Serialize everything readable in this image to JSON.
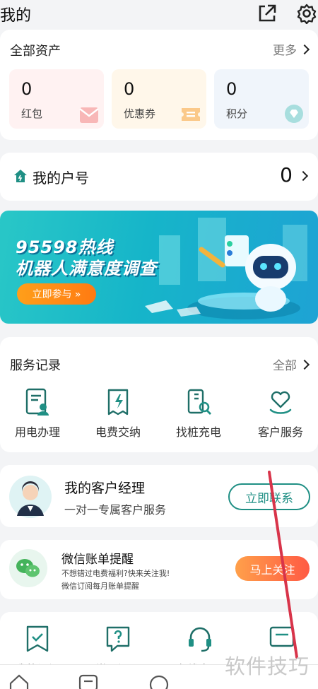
{
  "header": {
    "title": "我的",
    "share_icon": "share-external-icon",
    "settings_icon": "gear-icon"
  },
  "assets": {
    "title": "全部资产",
    "more": "更多",
    "items": [
      {
        "value": "0",
        "label": "红包",
        "bg": "#fff2f2",
        "icon": "envelope-icon"
      },
      {
        "value": "0",
        "label": "优惠券",
        "bg": "#fff7ea",
        "icon": "ticket-icon"
      },
      {
        "value": "0",
        "label": "积分",
        "bg": "#f0f5fb",
        "icon": "diamond-icon"
      }
    ]
  },
  "household": {
    "title": "我的户号",
    "count": "0",
    "icon": "home-icon"
  },
  "banner": {
    "line1": "95598热线",
    "line2": "机器人满意度调查",
    "button": "立即参与 »"
  },
  "service_records": {
    "title": "服务记录",
    "more": "全部",
    "items": [
      {
        "label": "用电办理",
        "icon": "document-user-icon"
      },
      {
        "label": "电费交纳",
        "icon": "bill-lightning-icon"
      },
      {
        "label": "找桩充电",
        "icon": "charger-search-icon"
      },
      {
        "label": "客户服务",
        "icon": "heart-hand-icon"
      }
    ]
  },
  "manager": {
    "title": "我的客户经理",
    "subtitle": "一对一专属客户服务",
    "button": "立即联系"
  },
  "wechat": {
    "title": "微信账单提醒",
    "line1": "不想错过电费福利?快来关注我!",
    "line2": "微信订阅每月账单提醒",
    "button": "马上关注"
  },
  "shortcuts": [
    {
      "label": "我的订阅",
      "icon": "bookmark-check-icon"
    },
    {
      "label": "常见问题",
      "icon": "question-icon"
    },
    {
      "label": "在线客服",
      "icon": "headset-icon"
    },
    {
      "label": "",
      "icon": "message-icon"
    }
  ],
  "watermark": "软件技巧",
  "colors": {
    "brand_green": "#1f8f84",
    "orange": "#ff7a12"
  }
}
